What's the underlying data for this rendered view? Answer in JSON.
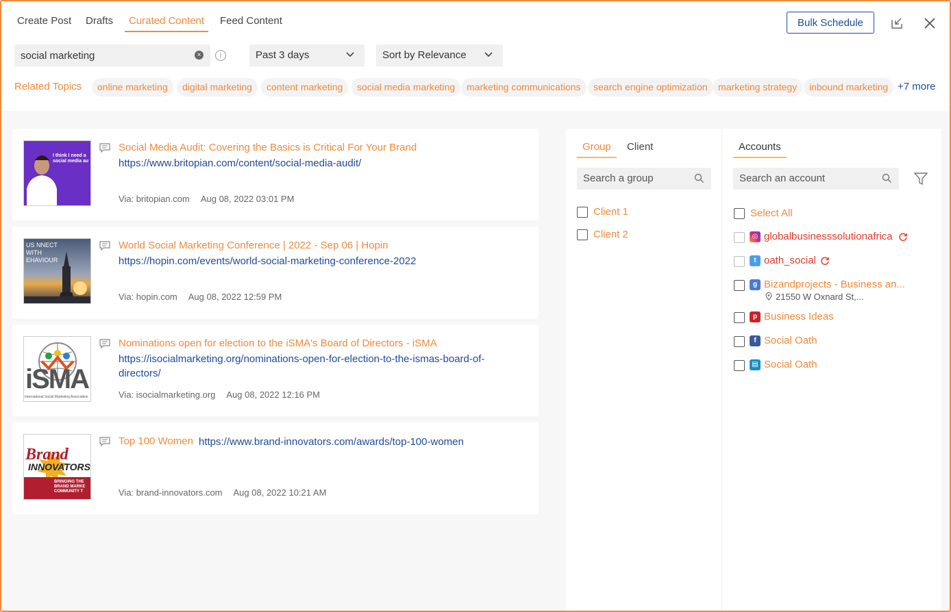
{
  "tabs": [
    {
      "label": "Create Post"
    },
    {
      "label": "Drafts"
    },
    {
      "label": "Curated Content"
    },
    {
      "label": "Feed Content"
    }
  ],
  "actions": {
    "bulk_schedule": "Bulk Schedule"
  },
  "search": {
    "query": "social marketing"
  },
  "filters": {
    "date": "Past 3 days",
    "sort": "Sort by Relevance"
  },
  "related": {
    "label": "Related Topics",
    "topics": [
      "online marketing",
      "digital marketing",
      "content marketing",
      "social media marketing",
      "marketing communications",
      "search engine optimization",
      "marketing strategy",
      "inbound marketing"
    ],
    "more": "+7 more"
  },
  "articles": [
    {
      "title": "Social Media Audit: Covering the Basics is Critical For Your Brand",
      "url": "https://www.britopian.com/content/social-media-audit/",
      "via": "Via: britopian.com",
      "date": "Aug 08, 2022 03:01 PM",
      "thumb_text": "I think I need a social media au"
    },
    {
      "title": "World Social Marketing Conference | 2022 - Sep 06 | Hopin",
      "url": "https://hopin.com/events/world-social-marketing-conference-2022",
      "via": "Via: hopin.com",
      "date": "Aug 08, 2022 12:59 PM",
      "thumb_text": "US NNECT WITH EHAVIOUR"
    },
    {
      "title": "Nominations open for election to the iSMA's Board of Directors - iSMA",
      "url_line1": "https://isocialmarketing.org/nominations-open-for-election-to-the-ismas-board-of-",
      "url_line2": "directors/",
      "via": "Via: isocialmarketing.org",
      "date": "Aug 08, 2022 12:16 PM",
      "thumb_text": "iSMA",
      "thumb_sub": "International Social Marketing Association"
    },
    {
      "title": "Top 100 Women",
      "url": "https://www.brand-innovators.com/awards/top-100-women",
      "via": "Via: brand-innovators.com",
      "date": "Aug 08, 2022 10:21 AM",
      "thumb_text1": "Brand",
      "thumb_text2": "INNOVATORS",
      "thumb_sub": "BRINGING THE BRAND MARKE COMMUNITY T"
    }
  ],
  "group_panel": {
    "tabs": [
      "Group",
      "Client"
    ],
    "search_placeholder": "Search a group",
    "items": [
      "Client 1",
      "Client 2"
    ]
  },
  "accounts_panel": {
    "tab": "Accounts",
    "search_placeholder": "Search an account",
    "select_all": "Select All",
    "items": [
      {
        "name": "globalbusinesssolutionafrica",
        "network": "instagram-icon",
        "status": "refresh-icon"
      },
      {
        "name": "oath_social",
        "network": "twitter-icon",
        "status": "refresh-icon"
      },
      {
        "name": "Bizandprojects - Business an...",
        "network": "google-business-icon",
        "address": "21550 W Oxnard St,..."
      },
      {
        "name": "Business Ideas",
        "network": "pinterest-icon"
      },
      {
        "name": "Social Oath",
        "network": "facebook-icon"
      },
      {
        "name": "Social Oath",
        "network": "linkedin-page-icon"
      }
    ]
  },
  "colors": {
    "accent": "#f08a3c",
    "link": "#1e4a9a",
    "error": "#e03c2c"
  }
}
